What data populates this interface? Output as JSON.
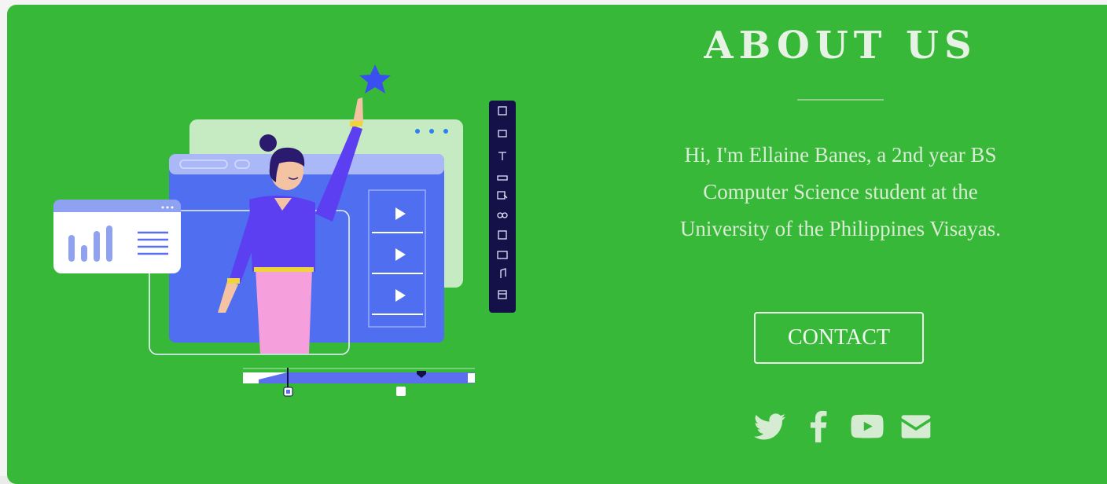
{
  "about": {
    "title": "ABOUT US",
    "description": "Hi, I'm Ellaine Banes, a 2nd year BS Computer Science student at the University of the Philippines Visayas.",
    "contact_label": "CONTACT"
  },
  "social": [
    {
      "name": "twitter-icon"
    },
    {
      "name": "facebook-icon"
    },
    {
      "name": "youtube-icon"
    },
    {
      "name": "email-icon"
    }
  ],
  "colors": {
    "background": "#38b838",
    "heading": "#e6f3e4",
    "text": "#d8ecd4",
    "icon": "#d6ecd2",
    "illustration_blue": "#4f6ef0",
    "illustration_purple": "#5b3ff0",
    "illustration_pink": "#f08fd6",
    "toolbar_dark": "#141048"
  },
  "icons": [
    "star-icon",
    "bar-chart-icon",
    "play-icon",
    "text-tool-icon",
    "music-icon"
  ]
}
